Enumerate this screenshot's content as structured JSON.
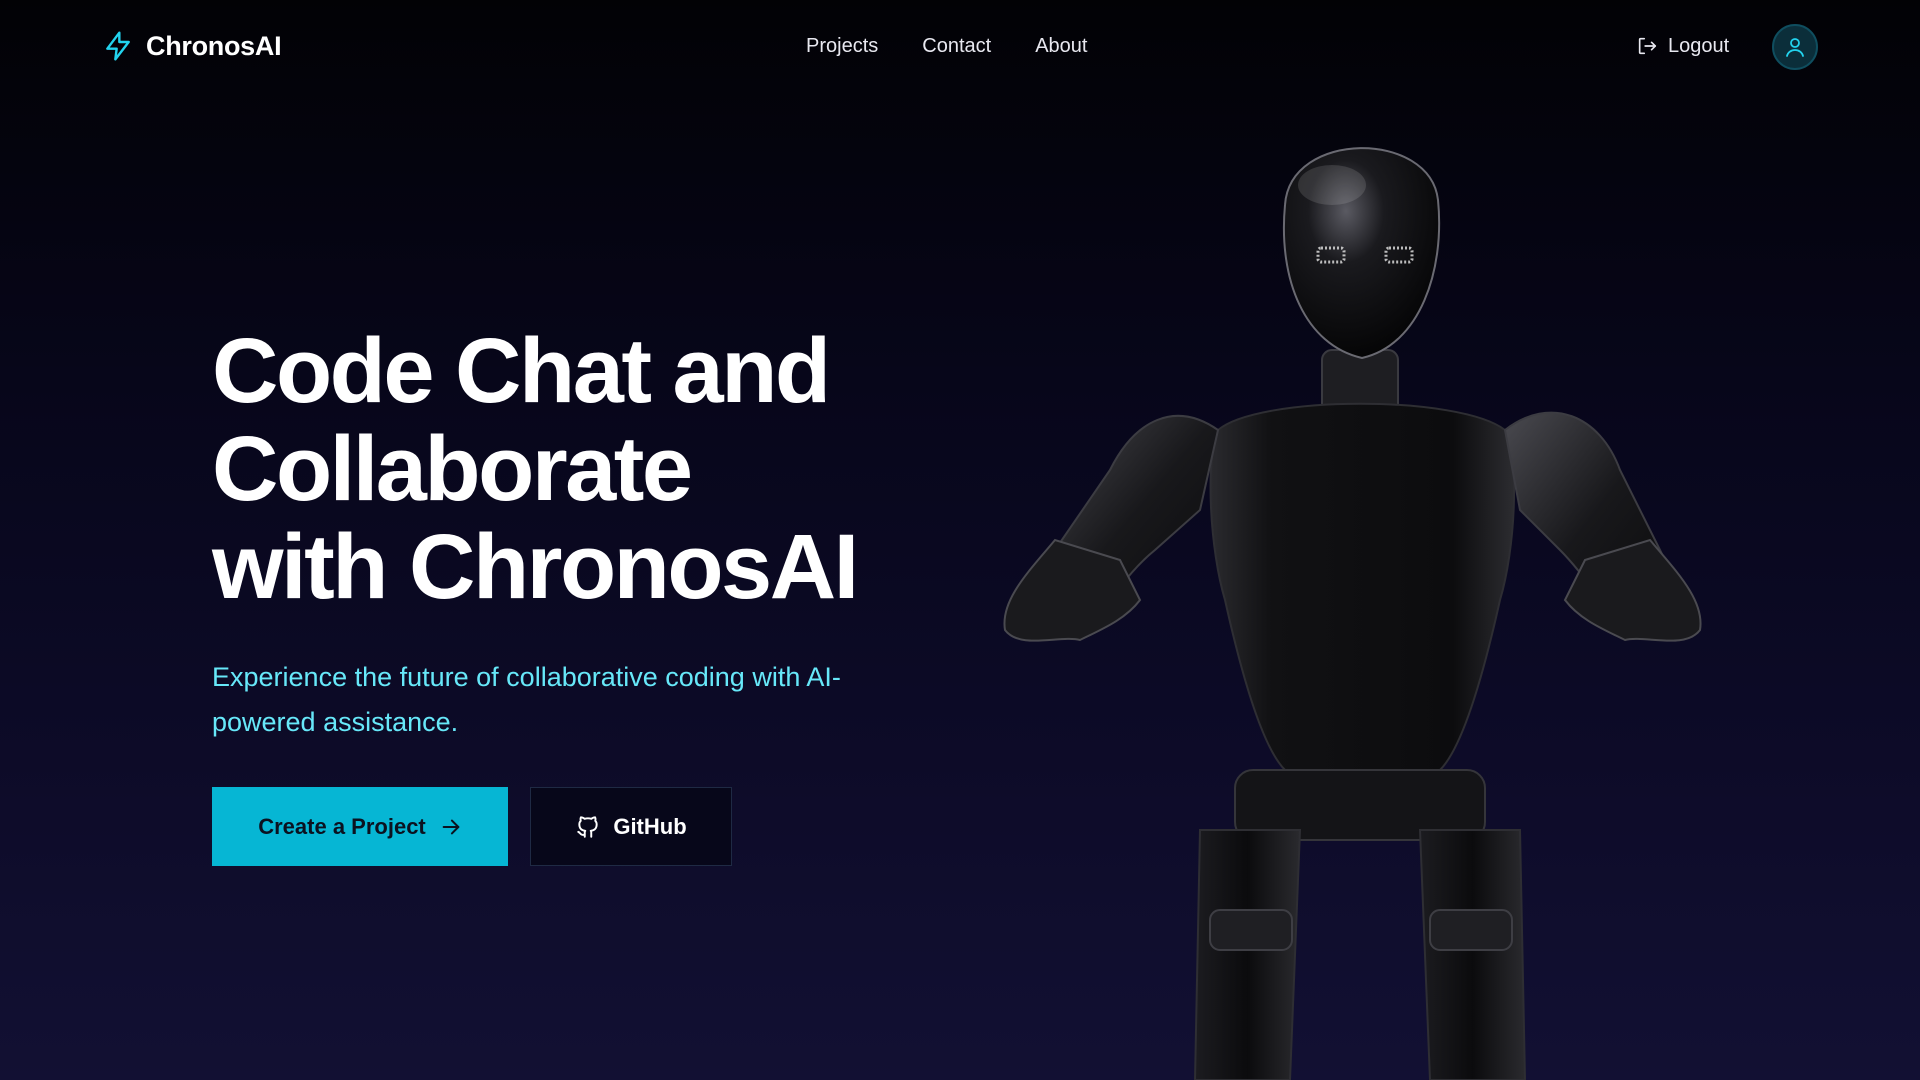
{
  "brand": {
    "name": "ChronosAI",
    "accent": "#22d3ee"
  },
  "nav": {
    "items": [
      "Projects",
      "Contact",
      "About"
    ]
  },
  "header": {
    "logout_label": "Logout",
    "logout_icon": "logout-icon",
    "avatar_icon": "user-icon"
  },
  "hero": {
    "title_lines": [
      "Code Chat and",
      "Collaborate",
      "with ChronosAI"
    ],
    "subtitle": "Experience the future of collaborative coding with AI-powered assistance.",
    "primary_button": "Create a Project",
    "secondary_button": "GitHub"
  },
  "colors": {
    "primary_button": "#06b6d4",
    "subtitle": "#67e8f9",
    "background_top": "#020205",
    "background_bottom": "#121033"
  }
}
